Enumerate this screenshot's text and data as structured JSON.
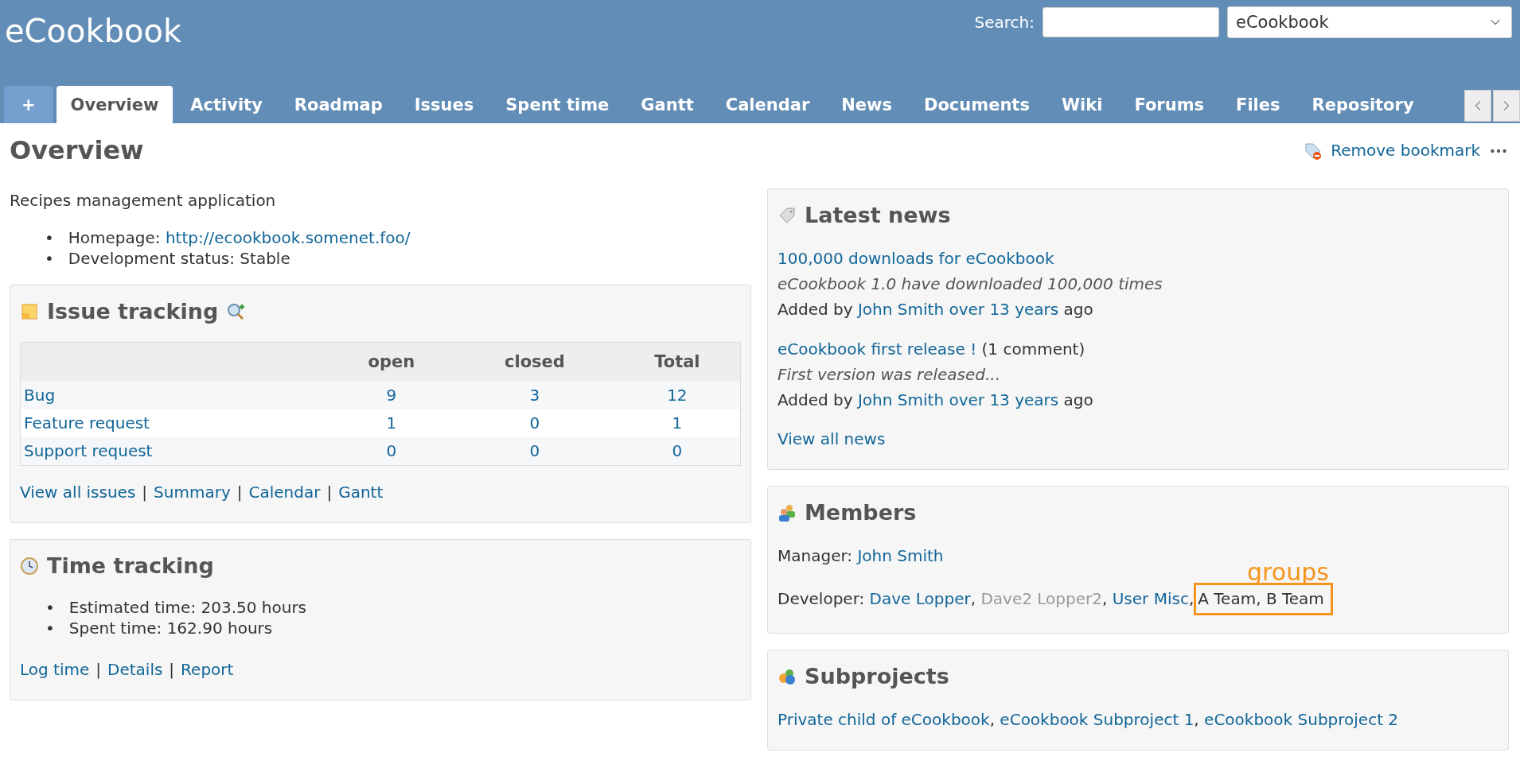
{
  "header": {
    "title": "eCookbook",
    "search_label": "Search:",
    "project_select": {
      "value": "eCookbook"
    }
  },
  "tabs": [
    {
      "label": "+",
      "kind": "add",
      "selected": false
    },
    {
      "label": "Overview",
      "kind": "tab",
      "selected": true
    },
    {
      "label": "Activity",
      "kind": "tab",
      "selected": false
    },
    {
      "label": "Roadmap",
      "kind": "tab",
      "selected": false
    },
    {
      "label": "Issues",
      "kind": "tab",
      "selected": false
    },
    {
      "label": "Spent time",
      "kind": "tab",
      "selected": false
    },
    {
      "label": "Gantt",
      "kind": "tab",
      "selected": false
    },
    {
      "label": "Calendar",
      "kind": "tab",
      "selected": false
    },
    {
      "label": "News",
      "kind": "tab",
      "selected": false
    },
    {
      "label": "Documents",
      "kind": "tab",
      "selected": false
    },
    {
      "label": "Wiki",
      "kind": "tab",
      "selected": false
    },
    {
      "label": "Forums",
      "kind": "tab",
      "selected": false
    },
    {
      "label": "Files",
      "kind": "tab",
      "selected": false
    },
    {
      "label": "Repository",
      "kind": "tab",
      "selected": false
    }
  ],
  "page": {
    "title": "Overview",
    "bookmark_action": "Remove bookmark",
    "description": "Recipes management application",
    "bullet": "•",
    "fields": [
      {
        "label": "Homepage:",
        "value": "http://ecookbook.somenet.foo/",
        "link": true
      },
      {
        "label": "Development status:",
        "value": "Stable",
        "link": false
      }
    ]
  },
  "issue_tracking": {
    "title": "Issue tracking",
    "columns": [
      "open",
      "closed",
      "Total"
    ],
    "rows": [
      {
        "tracker": "Bug",
        "open": "9",
        "closed": "3",
        "total": "12"
      },
      {
        "tracker": "Feature request",
        "open": "1",
        "closed": "0",
        "total": "1"
      },
      {
        "tracker": "Support request",
        "open": "0",
        "closed": "0",
        "total": "0"
      }
    ],
    "links": [
      "View all issues",
      "Summary",
      "Calendar",
      "Gantt"
    ],
    "separator": "|"
  },
  "time_tracking": {
    "title": "Time tracking",
    "bullet": "•",
    "items": [
      "Estimated time: 203.50 hours",
      "Spent time: 162.90 hours"
    ],
    "links": [
      "Log time",
      "Details",
      "Report"
    ],
    "separator": "|"
  },
  "latest_news": {
    "title": "Latest news",
    "items": [
      {
        "title": "100,000 downloads for eCookbook",
        "summary": "eCookbook 1.0 have downloaded 100,000 times",
        "added_prefix": "Added by",
        "author": "John Smith",
        "age": "over 13 years",
        "age_suffix": "ago"
      },
      {
        "title": "eCookbook first release !",
        "comments": "(1 comment)",
        "summary": "First version was released...",
        "added_prefix": "Added by",
        "author": "John Smith",
        "age": "over 13 years",
        "age_suffix": "ago"
      }
    ],
    "view_all": "View all news"
  },
  "members": {
    "title": "Members",
    "separator": ",",
    "annotation": "groups",
    "roles": [
      {
        "role": "Manager:",
        "members": [
          {
            "name": "John Smith",
            "kind": "user",
            "locked": false
          }
        ]
      },
      {
        "role": "Developer:",
        "members": [
          {
            "name": "Dave Lopper",
            "kind": "user",
            "locked": false
          },
          {
            "name": "Dave2 Lopper2",
            "kind": "user",
            "locked": true
          },
          {
            "name": "User Misc",
            "kind": "user",
            "locked": false
          },
          {
            "name": "A Team",
            "kind": "group"
          },
          {
            "name": "B Team",
            "kind": "group"
          }
        ]
      }
    ]
  },
  "subprojects": {
    "title": "Subprojects",
    "separator": ",",
    "items": [
      "Private child of eCookbook",
      "eCookbook Subproject 1",
      "eCookbook Subproject 2"
    ]
  }
}
